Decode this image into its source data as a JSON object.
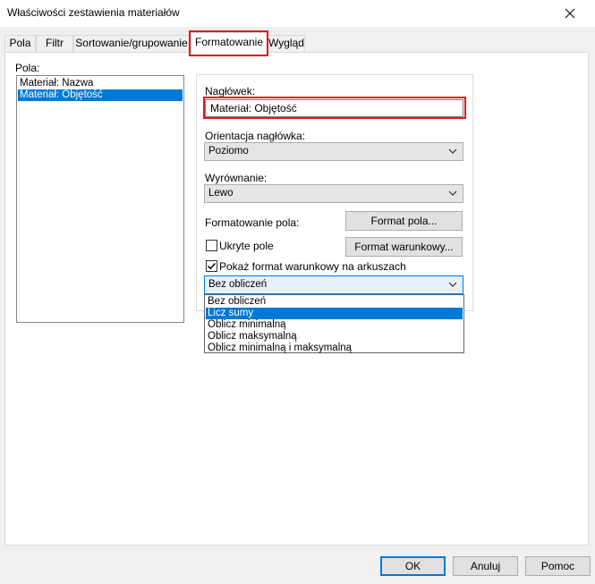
{
  "window": {
    "title": "Właściwości zestawienia materiałów"
  },
  "tabs": [
    {
      "label": "Pola"
    },
    {
      "label": "Filtr"
    },
    {
      "label": "Sortowanie/grupowanie"
    },
    {
      "label": "Formatowanie"
    },
    {
      "label": "Wygląd"
    }
  ],
  "active_tab": "Formatowanie",
  "fields": {
    "label": "Pola:",
    "items": [
      {
        "label": "Materiał: Nazwa",
        "selected": false
      },
      {
        "label": "Materiał: Objętość",
        "selected": true
      }
    ]
  },
  "format": {
    "header_label": "Nagłówek:",
    "header_value": "Materiał: Objętość",
    "orientation_label": "Orientacja nagłówka:",
    "orientation_value": "Poziomo",
    "alignment_label": "Wyrównanie:",
    "alignment_value": "Lewo",
    "field_format_label": "Formatowanie pola:",
    "field_format_button": "Format pola...",
    "hidden_field_label": "Ukryte pole",
    "hidden_field_checked": false,
    "conditional_format_button": "Format warunkowy...",
    "show_conditional_label": "Pokaż format warunkowy na arkuszach",
    "show_conditional_checked": true,
    "calculation_value": "Bez obliczeń",
    "calculation_options": [
      {
        "label": "Bez obliczeń",
        "selected": false
      },
      {
        "label": "Licz sumy",
        "selected": true
      },
      {
        "label": "Oblicz minimalną",
        "selected": false
      },
      {
        "label": "Oblicz maksymalną",
        "selected": false
      },
      {
        "label": "Oblicz minimalną i maksymalną",
        "selected": false
      }
    ]
  },
  "footer": {
    "ok_label": "OK",
    "cancel_label": "Anuluj",
    "help_label": "Pomoc"
  },
  "colors": {
    "accent": "#0078d7",
    "highlight": "#e31a1a"
  }
}
